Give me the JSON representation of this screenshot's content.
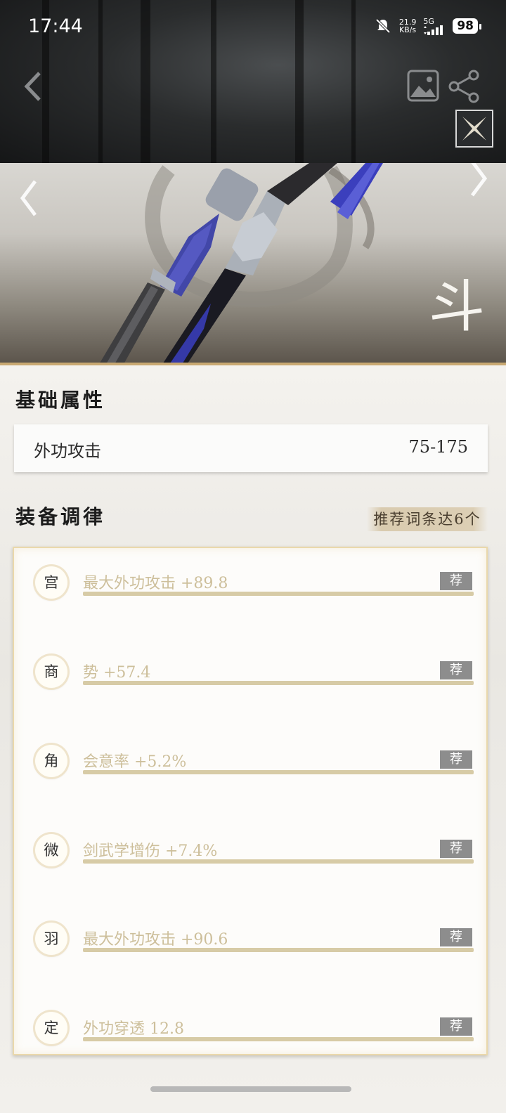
{
  "status_bar": {
    "time": "17:44",
    "net_speed_value": "21.9",
    "net_speed_unit": "KB/s",
    "network": "5G",
    "battery": "98"
  },
  "icons": {
    "back": "chevron-left-icon",
    "image": "image-icon",
    "share": "share-icon",
    "badge": "crossed-blades-icon",
    "prev": "chevron-left-icon",
    "next": "chevron-right-icon"
  },
  "base_attributes": {
    "title": "基础属性",
    "items": [
      {
        "name": "外功攻击",
        "value": "75-175"
      }
    ]
  },
  "tuning": {
    "title": "装备调律",
    "recommend_label": "推荐词条达6个",
    "rows": [
      {
        "note": "宫",
        "text": "最大外功攻击  +89.8",
        "badge": "荐"
      },
      {
        "note": "商",
        "text": "势  +57.4",
        "badge": "荐"
      },
      {
        "note": "角",
        "text": "会意率  +5.2%",
        "badge": "荐"
      },
      {
        "note": "微",
        "text": "剑武学增伤  +7.4%",
        "badge": "荐"
      },
      {
        "note": "羽",
        "text": "最大外功攻击  +90.6",
        "badge": "荐"
      },
      {
        "note": "定",
        "text": "外功穿透  12.8",
        "badge": "荐"
      }
    ]
  },
  "colors": {
    "accent_gold": "#c9a972",
    "tune_text": "#cdbf9b",
    "badge_gray": "#8d8d8d"
  }
}
